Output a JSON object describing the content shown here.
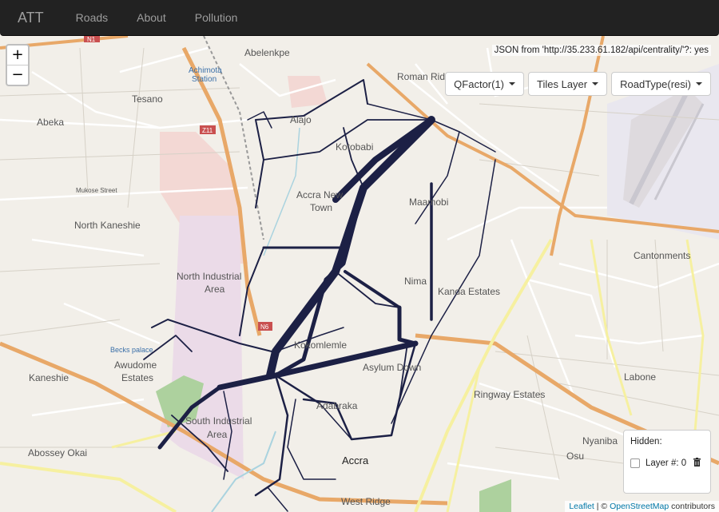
{
  "navbar": {
    "brand": "ATT",
    "links": [
      "Roads",
      "About",
      "Pollution"
    ]
  },
  "zoom": {
    "in": "+",
    "out": "−"
  },
  "json_source": "JSON from 'http://35.233.61.182/api/centrality/'?: yes",
  "dropdowns": [
    "QFactor(1)",
    "Tiles Layer",
    "RoadType(resi)"
  ],
  "hidden_panel": {
    "title": "Hidden:",
    "layer_label": "Layer #: 0"
  },
  "attribution": {
    "leaflet": "Leaflet",
    "separator": " | © ",
    "osm": "OpenStreetMap",
    "suffix": " contributors"
  },
  "map_labels": {
    "abelenkpe": "Abelenkpe",
    "roman_ridge": "Roman Ridge",
    "achimota": "Achimota",
    "station": "Station",
    "tesano": "Tesano",
    "alajo": "Alajo",
    "abeka": "Abeka",
    "kotobabi": "Kotobabi",
    "mukose": "Mukose Street",
    "accra_new": "Accra New",
    "town": "Town",
    "maamobi": "Maamobi",
    "north_kaneshie": "North Kaneshie",
    "north_industrial": "North Industrial",
    "area1": "Area",
    "cantonments": "Cantonments",
    "nima": "Nima",
    "kanda": "Kanda Estates",
    "becks": "Becks palace",
    "kokomlemle": "Kokomlemle",
    "awudome": "Awudome",
    "estates": "Estates",
    "asylum": "Asylum Down",
    "labone": "Labone",
    "kaneshie": "Kaneshie",
    "ringway": "Ringway Estates",
    "adabraka": "Adabraka",
    "south_industrial": "South Industrial",
    "area2": "Area",
    "abossey": "Abossey Okai",
    "osu": "Osu",
    "nyaniba": "Nyaniba",
    "accra": "Accra",
    "west_ridge": "West Ridge",
    "n1": "N1",
    "z11": "Z11",
    "n6": "N6"
  },
  "colors": {
    "navbar": "#222222",
    "nav_text": "#9d9d9d",
    "map_bg": "#f2efe9",
    "network": "#1c2045",
    "major_road": "#e8a868",
    "yellow_road": "#f6f0a0"
  }
}
